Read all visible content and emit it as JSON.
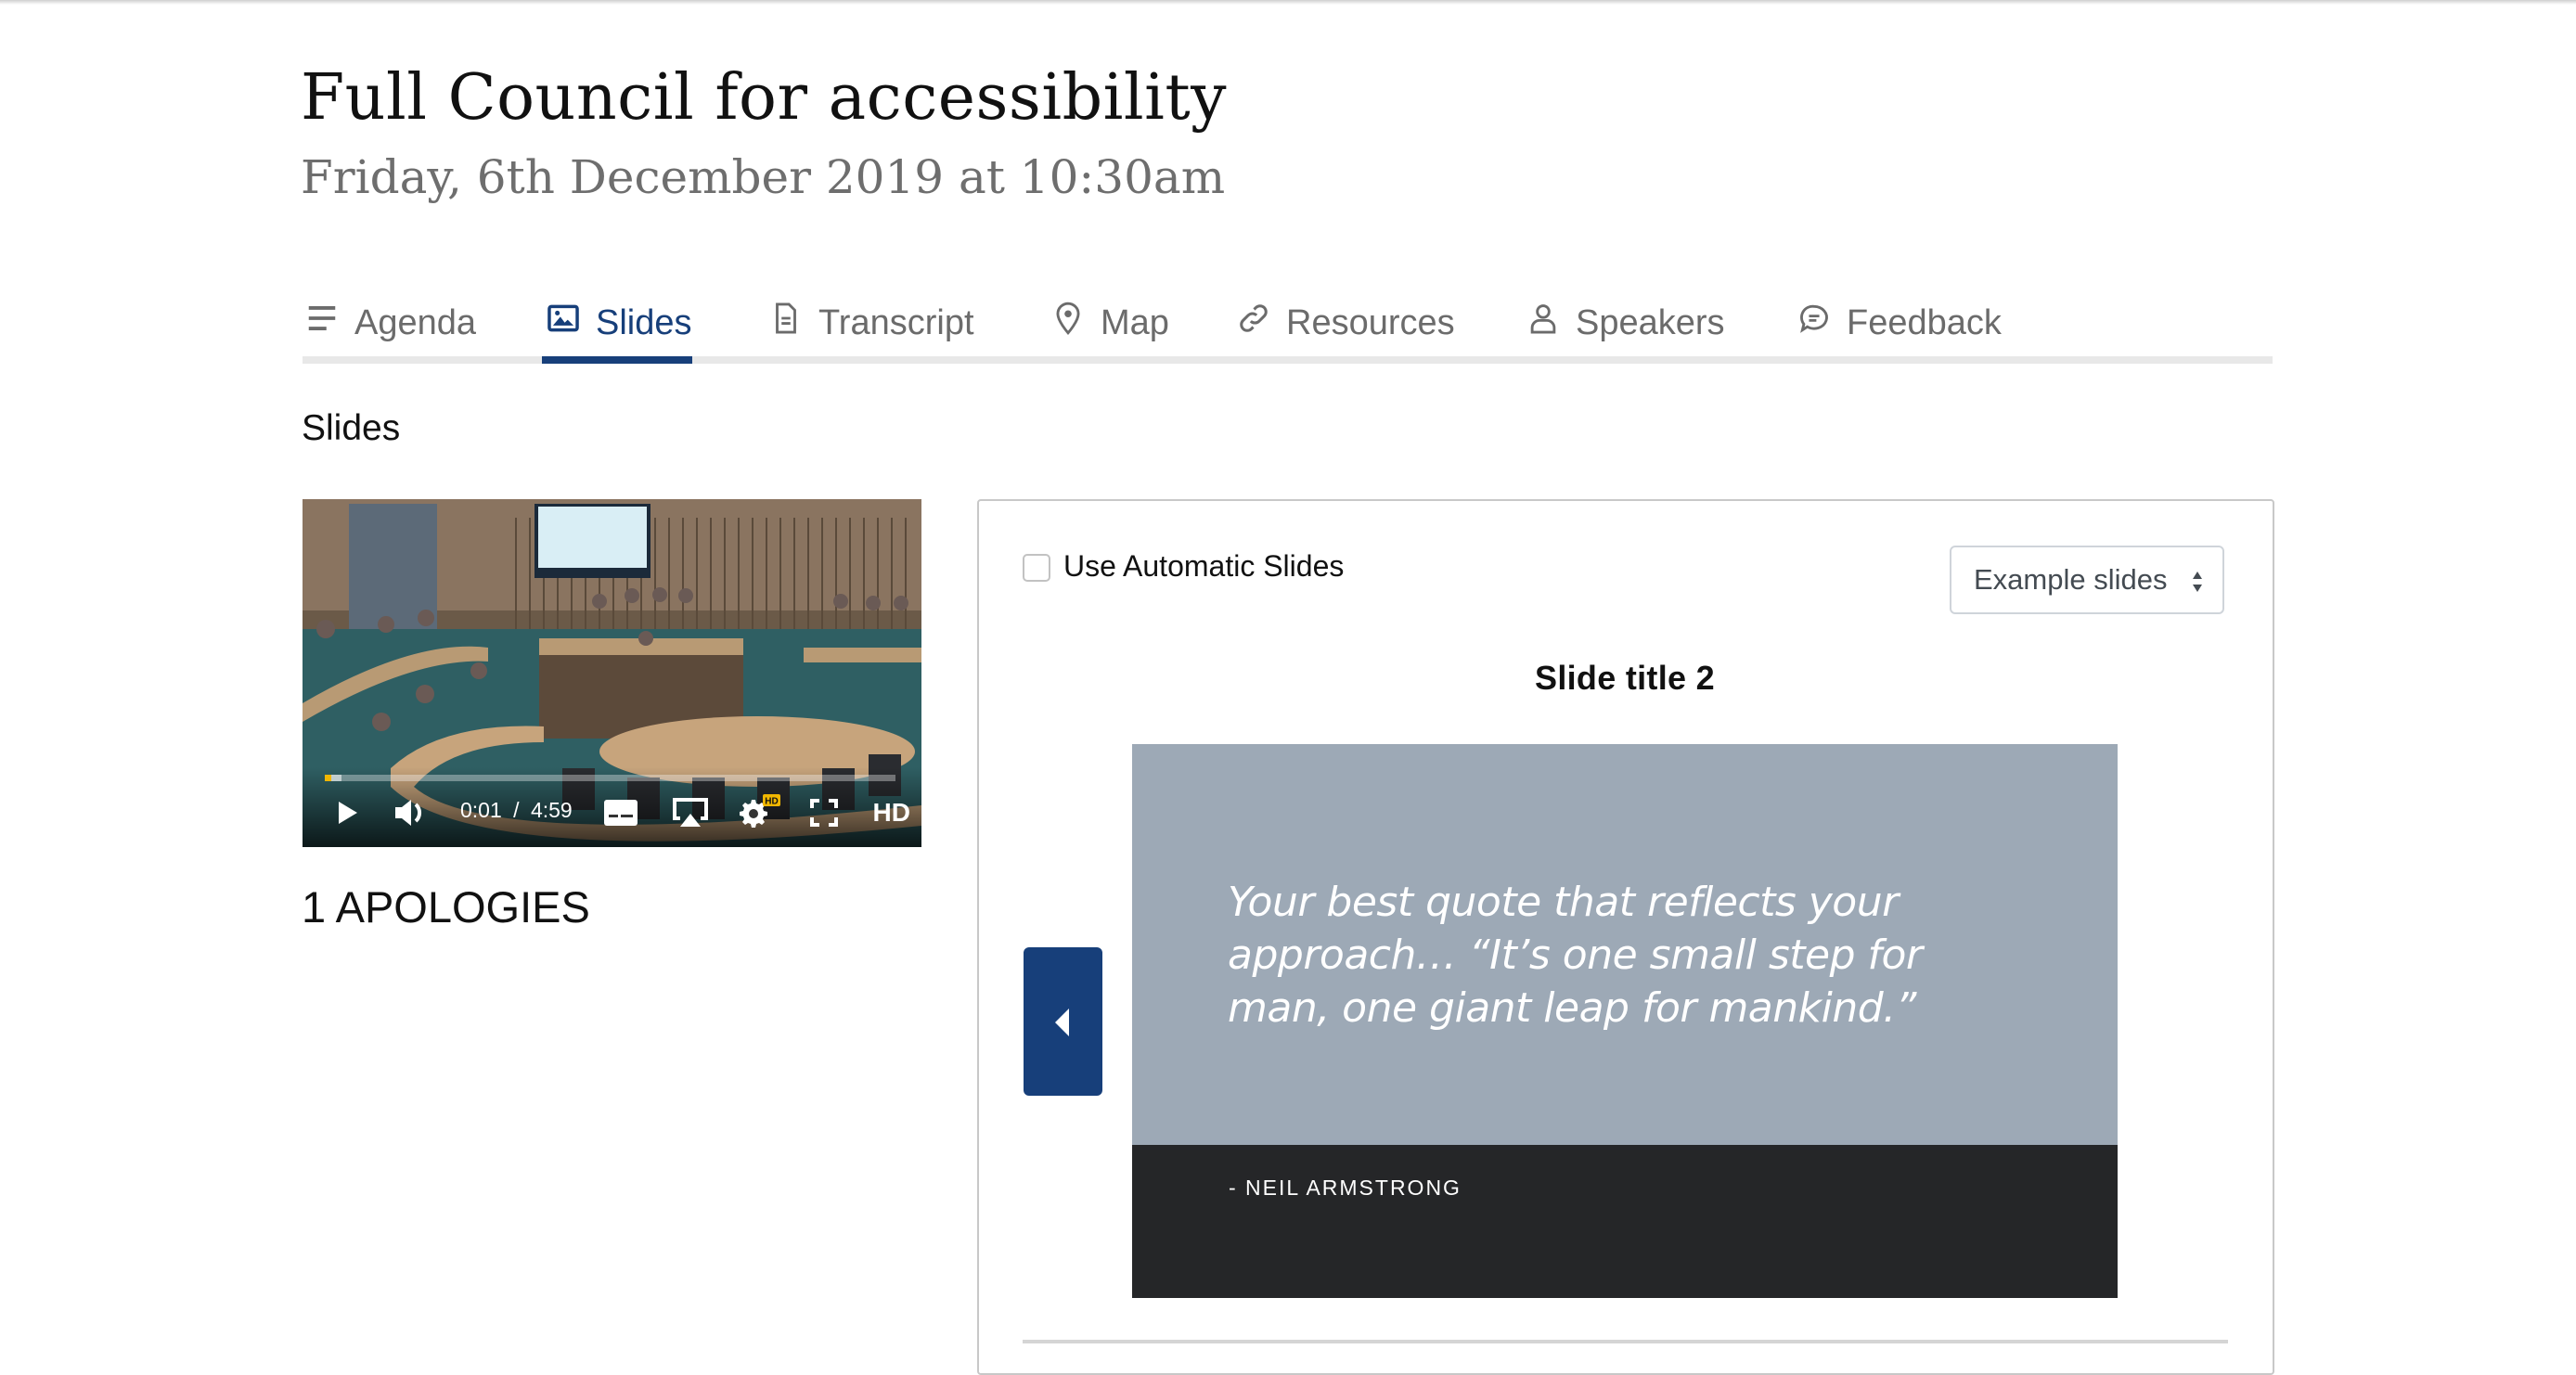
{
  "meeting": {
    "title": "Full Council for accessibility",
    "datetime": "Friday, 6th December 2019 at 10:30am"
  },
  "tabs": [
    {
      "label": "Agenda",
      "icon": "list-icon",
      "active": false
    },
    {
      "label": "Slides",
      "icon": "image-icon",
      "active": true
    },
    {
      "label": "Transcript",
      "icon": "document-icon",
      "active": false
    },
    {
      "label": "Map",
      "icon": "map-pin-icon",
      "active": false
    },
    {
      "label": "Resources",
      "icon": "link-icon",
      "active": false
    },
    {
      "label": "Speakers",
      "icon": "user-icon",
      "active": false
    },
    {
      "label": "Feedback",
      "icon": "chat-icon",
      "active": false
    }
  ],
  "section_heading": "Slides",
  "video": {
    "current_time": "0:01",
    "separator": "/",
    "duration": "4:59",
    "progress_fraction": 0.003,
    "buffered_fraction": 0.03,
    "quality_badge": "HD",
    "settings_badge": "HD",
    "accent_color": "#f1b600"
  },
  "agenda_item": "1 APOLOGIES",
  "slides_panel": {
    "auto_slides_label": "Use Automatic Slides",
    "auto_slides_checked": false,
    "slide_set_select": "Example slides",
    "slide_title": "Slide title 2",
    "slide": {
      "quote": "Your best quote that reflects your approach… “It’s one small step for man, one giant leap for mankind.”",
      "author": "- NEIL ARMSTRONG"
    },
    "prev_button_label": "Previous slide"
  },
  "colors": {
    "brand": "#173f7a",
    "tab_inactive": "#6b6b6b",
    "slide_bg": "#9da9b6",
    "slide_band": "#252628"
  }
}
